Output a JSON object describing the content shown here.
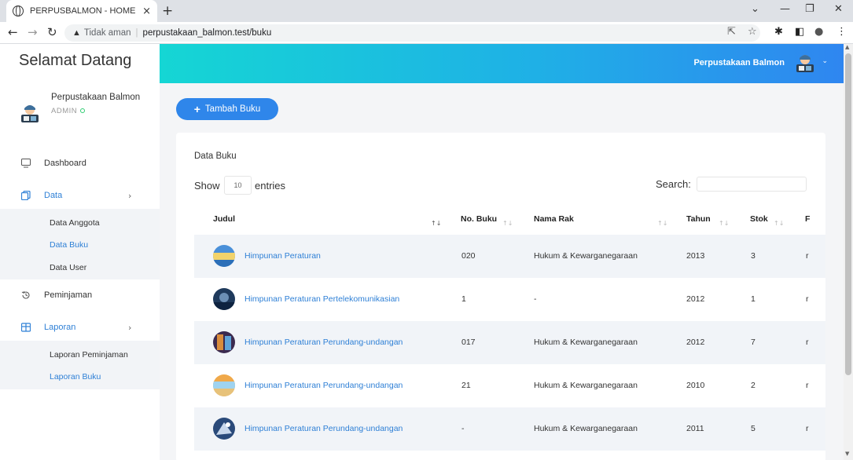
{
  "browser": {
    "tab_title": "PERPUSBALMON - HOME",
    "security_label": "Tidak aman",
    "url": "perpustakaan_balmon.test/buku"
  },
  "sidebar": {
    "welcome": "Selamat Datang",
    "user_name": "Perpustakaan Balmon",
    "user_role": "ADMIN",
    "menu": [
      {
        "label": "Dashboard",
        "icon": "monitor-icon"
      },
      {
        "label": "Data",
        "icon": "copy-icon"
      },
      {
        "label": "Peminjaman",
        "icon": "history-icon"
      },
      {
        "label": "Laporan",
        "icon": "table-icon"
      }
    ],
    "data_sub": [
      "Data Anggota",
      "Data Buku",
      "Data User"
    ],
    "laporan_sub": [
      "Laporan Peminjaman",
      "Laporan Buku"
    ]
  },
  "header": {
    "user_name": "Perpustakaan Balmon"
  },
  "content": {
    "add_button": "Tambah Buku",
    "card_title": "Data Buku",
    "show_label": "Show",
    "entries_value": "10",
    "entries_label": "entries",
    "search_label": "Search:",
    "columns": [
      "Judul",
      "No. Buku",
      "Nama Rak",
      "Tahun",
      "Stok",
      "F"
    ],
    "rows": [
      {
        "judul": "Himpunan Peraturan",
        "no_buku": "020",
        "rak": "Hukum & Kewarganegaraan",
        "tahun": "2013",
        "stok": "3",
        "extra": "r"
      },
      {
        "judul": "Himpunan Peraturan Pertelekomunikasian",
        "no_buku": "1",
        "rak": "-",
        "tahun": "2012",
        "stok": "1",
        "extra": "r"
      },
      {
        "judul": "Himpunan Peraturan Perundang-undangan",
        "no_buku": "017",
        "rak": "Hukum & Kewarganegaraan",
        "tahun": "2012",
        "stok": "7",
        "extra": "r"
      },
      {
        "judul": "Himpunan Peraturan Perundang-undangan",
        "no_buku": "21",
        "rak": "Hukum & Kewarganegaraan",
        "tahun": "2010",
        "stok": "2",
        "extra": "r"
      },
      {
        "judul": "Himpunan Peraturan Perundang-undangan",
        "no_buku": "-",
        "rak": "Hukum & Kewarganegaraan",
        "tahun": "2011",
        "stok": "5",
        "extra": "r"
      }
    ]
  },
  "colors": {
    "accent": "#2f86ea",
    "link": "#2f80d6",
    "header_start": "#15d6d4",
    "header_end": "#2f86f0"
  }
}
